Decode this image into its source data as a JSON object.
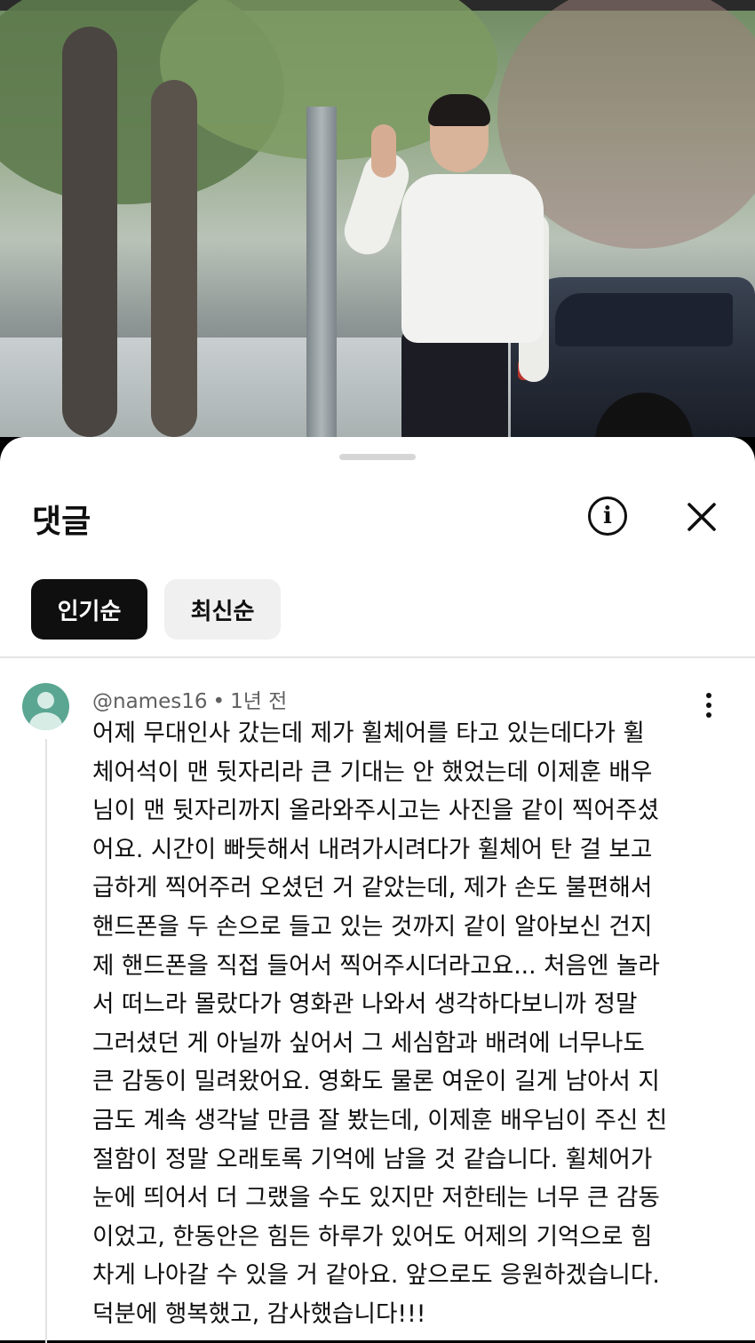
{
  "sheet": {
    "title": "댓글",
    "info_icon": "info-circle-icon",
    "close_icon": "close-icon"
  },
  "sort_chips": [
    {
      "label": "인기순",
      "selected": true
    },
    {
      "label": "최신순",
      "selected": false
    }
  ],
  "comment": {
    "author": "@names16",
    "separator": "•",
    "time": "1년 전",
    "lines": [
      "어제 무대인사 갔는데 제가 휠체어를 타고 있는데다가 휠",
      "체어석이 맨 뒷자리라 큰 기대는 안 했었는데 이제훈 배우",
      "님이 맨 뒷자리까지 올라와주시고는 사진을 같이 찍어주셨",
      "어요. 시간이 빠듯해서 내려가시려다가 휠체어 탄 걸 보고",
      "급하게 찍어주러 오셨던 거 같았는데, 제가 손도 불편해서",
      "핸드폰을 두 손으로 들고 있는 것까지 같이 알아보신 건지",
      "제 핸드폰을 직접 들어서 찍어주시더라고요... 처음엔 놀라",
      "서 떠느라 몰랐다가 영화관 나와서 생각하다보니까 정말",
      "그러셨던 게 아닐까 싶어서 그 세심함과 배려에 너무나도",
      "큰 감동이 밀려왔어요. 영화도 물론 여운이 길게 남아서 지",
      "금도 계속 생각날 만큼 잘 봤는데, 이제훈 배우님이 주신 친",
      "절함이 정말 오래토록 기억에 남을 것 같습니다. 휠체어가",
      "눈에 띄어서 더 그랬을 수도 있지만 저한테는 너무 큰 감동",
      "이었고, 한동안은 힘든 하루가 있어도 어제의 기억으로 힘",
      "차게 나아갈 수 있을 거 같아요. 앞으로도 응원하겠습니다.",
      "덕분에 행복했고, 감사했습니다!!!"
    ]
  },
  "colors": {
    "chip_selected_bg": "#0f0f0f",
    "chip_unselected_bg": "#f0f0f0",
    "avatar_bg": "#5aa692",
    "meta_text": "#606060"
  }
}
